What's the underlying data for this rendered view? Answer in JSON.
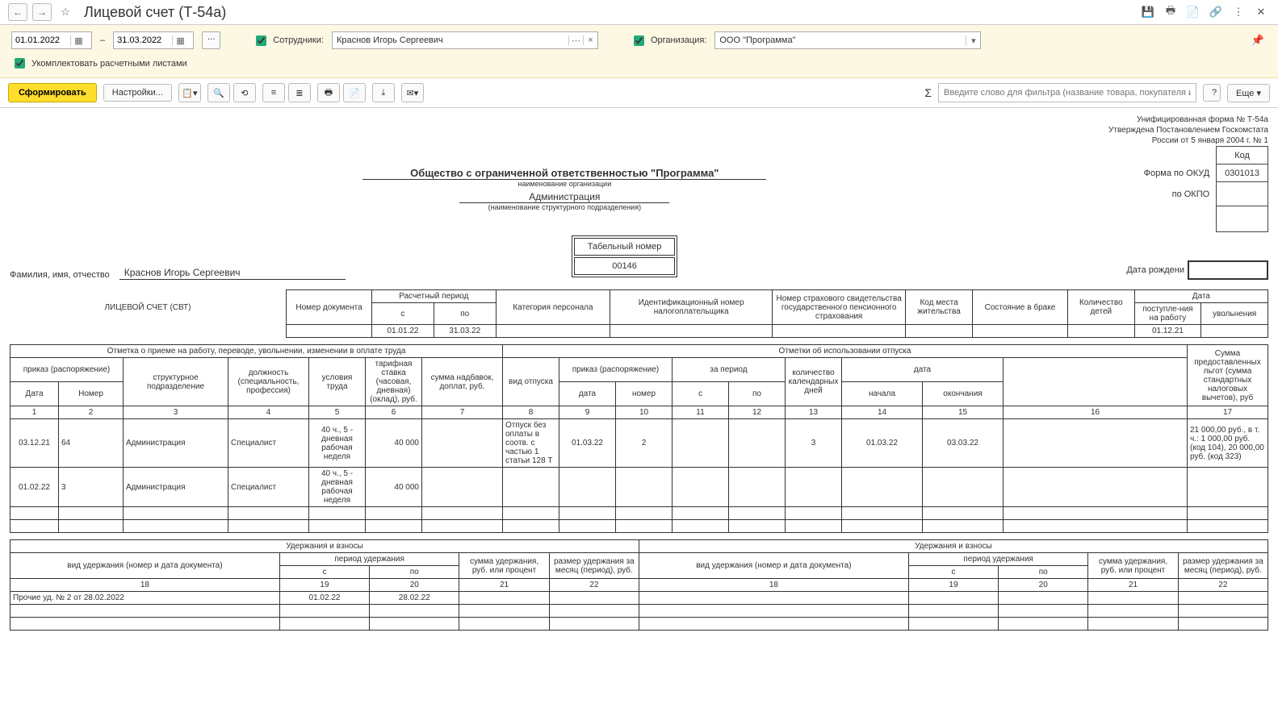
{
  "title": "Лицевой счет (Т-54а)",
  "filters": {
    "date_from": "01.01.2022",
    "date_to": "31.03.2022",
    "dash": "–",
    "ellipsis": "...",
    "employees_label": "Сотрудники:",
    "employee_value": "Краснов Игорь Сергеевич",
    "org_label": "Организация:",
    "org_value": "ООО \"Программа\"",
    "chk_paysheets": "Укомплектовать расчетными листами"
  },
  "actions": {
    "generate": "Сформировать",
    "settings": "Настройки...",
    "more": "Еще",
    "filter_placeholder": "Введите слово для фильтра (название товара, покупателя и пр.)",
    "sigma": "Σ",
    "q": "?"
  },
  "report": {
    "meta1": "Унифицированная форма № Т-54а",
    "meta2": "Утверждена Постановлением Госкомстата",
    "meta3": "России от 5 января 2004 г. № 1",
    "code_lab": "Код",
    "okud_lab": "Форма по ОКУД",
    "okud_val": "0301013",
    "okpo_lab": "по ОКПО",
    "org_full": "Общество с ограниченной ответственностью \"Программа\"",
    "org_sub": "наименование организации",
    "dept": "Администрация",
    "dept_sub": "(наименование структурного подразделения)",
    "tabno_lab": "Табельный номер",
    "tabno_val": "00146",
    "fio_lab": "Фамилия, имя, отчество",
    "fio_val": "Краснов Игорь Сергеевич",
    "dob_lab": "Дата рождени",
    "card_title": "ЛИЦЕВОЙ СЧЕТ (СВТ)"
  },
  "t1": {
    "doc_no": "Номер документа",
    "period": "Расчетный период",
    "from": "с",
    "to": "по",
    "cat": "Категория персонала",
    "inn": "Идентификационный номер налогоплательщика",
    "pens": "Номер страхового свидетельства государственного пенсионного страхования",
    "place": "Код места жительства",
    "marital": "Состояние в браке",
    "children": "Количество детей",
    "date": "Дата",
    "date_in": "поступле-ния на работу",
    "date_out": "увольнения",
    "v_from": "01.01.22",
    "v_to": "31.03.22",
    "v_date_in": "01.12.21"
  },
  "t2": {
    "hire_head": "Отметка о приеме на работу, переводе, увольнении, изменении в оплате труда",
    "vac_head": "Отметки об использовании отпуска",
    "order": "приказ (распоряжение)",
    "date": "Дата",
    "num": "Номер",
    "dept": "структурное подразделение",
    "pos": "должность (специальность, профессия)",
    "work": "условия труда",
    "rate": "тарифная ставка (часовая, дневная) (оклад), руб.",
    "addon": "сумма надбавок, доплат, руб.",
    "vac_type": "вид отпуска",
    "period": "за период",
    "days": "количество календарных дней",
    "dates": "дата",
    "start": "начала",
    "end": "окончания",
    "benefits": "Сумма предоставленных льгот (сумма стандартных налоговых вычетов), руб",
    "p_from": "с",
    "p_to": "по",
    "o_date": "дата",
    "o_num": "номер",
    "nums": [
      "1",
      "2",
      "3",
      "4",
      "5",
      "6",
      "7",
      "8",
      "9",
      "10",
      "11",
      "12",
      "13",
      "14",
      "15",
      "16",
      "17"
    ],
    "r1": {
      "d": "03.12.21",
      "n": "64",
      "dept": "Администрация",
      "pos": "Специалист",
      "work": "40 ч., 5 - дневная рабочая неделя",
      "rate": "40 000",
      "vtype": "Отпуск без оплаты в соотв. с частью 1 статьи 128 Т",
      "od": "01.03.22",
      "on": "2",
      "days": "3",
      "st": "01.03.22",
      "en": "03.03.22",
      "ben": "21 000,00 руб., в т. ч.: 1 000,00 руб. (код 104), 20 000,00 руб. (код 323)"
    },
    "r2": {
      "d": "01.02.22",
      "n": "3",
      "dept": "Администрация",
      "pos": "Специалист",
      "work": "40 ч., 5 - дневная рабочая неделя",
      "rate": "40 000"
    }
  },
  "t3": {
    "head": "Удержания и взносы",
    "type": "вид удержания (номер и дата документа)",
    "period": "период удержания",
    "sum": "сумма удержания, руб. или процент",
    "size": "размер удержания за месяц (период), руб.",
    "from": "с",
    "to": "по",
    "nums": [
      "18",
      "19",
      "20",
      "21",
      "22"
    ],
    "r1": {
      "type": "Прочие уд. № 2 от 28.02.2022",
      "from": "01.02.22",
      "to": "28.02.22"
    }
  }
}
